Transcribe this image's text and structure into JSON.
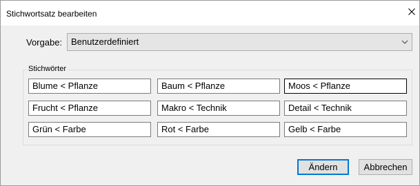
{
  "window": {
    "title": "Stichwortsatz bearbeiten",
    "close_glyph": "×"
  },
  "preset": {
    "label": "Vorgabe:",
    "selected": "Benutzerdefiniert"
  },
  "keywords": {
    "legend": "Stichwörter",
    "items": [
      "Blume < Pflanze",
      "Baum < Pflanze",
      "Moos < Pflanze",
      "Frucht < Pflanze",
      "Makro < Technik",
      "Detail < Technik",
      "Grün < Farbe",
      "Rot < Farbe",
      "Gelb < Farbe"
    ],
    "focused_index": 2
  },
  "buttons": {
    "change": "Ändern",
    "cancel": "Abbrechen"
  },
  "colors": {
    "dialog_bg": "#f0f0f0",
    "default_button_border": "#0078d7"
  }
}
